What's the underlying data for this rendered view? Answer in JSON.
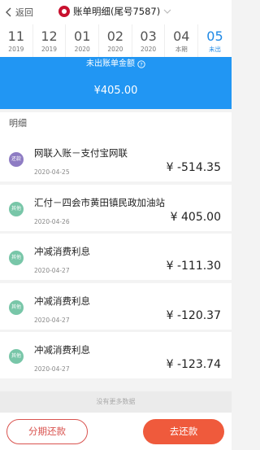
{
  "header": {
    "back_label": "返回",
    "title": "账单明细(尾号7587)"
  },
  "months": [
    {
      "num": "11",
      "sub": "2019"
    },
    {
      "num": "12",
      "sub": "2019"
    },
    {
      "num": "01",
      "sub": "2020"
    },
    {
      "num": "02",
      "sub": "2020"
    },
    {
      "num": "03",
      "sub": "2020"
    },
    {
      "num": "04",
      "sub": "本期"
    },
    {
      "num": "05",
      "sub": "未出"
    }
  ],
  "active_month_index": 6,
  "banner": {
    "label": "未出账单金额",
    "amount": "¥405.00"
  },
  "section_title": "明细",
  "items": [
    {
      "badge": "还款",
      "badge_color": "#8e7cc3",
      "title": "网联入账－支付宝网联",
      "date": "2020-04-25",
      "amount": "¥ -514.35"
    },
    {
      "badge": "其他",
      "badge_color": "#78c6a8",
      "title": "汇付－四会市黄田镇民政加油站",
      "date": "2020-04-26",
      "amount": "¥ 405.00"
    },
    {
      "badge": "其他",
      "badge_color": "#78c6a8",
      "title": "冲减消费利息",
      "date": "2020-04-27",
      "amount": "¥ -111.30"
    },
    {
      "badge": "其他",
      "badge_color": "#78c6a8",
      "title": "冲减消费利息",
      "date": "2020-04-27",
      "amount": "¥ -120.37"
    },
    {
      "badge": "其他",
      "badge_color": "#78c6a8",
      "title": "冲减消费利息",
      "date": "2020-04-27",
      "amount": "¥ -123.74"
    }
  ],
  "no_more_text": "没有更多数据",
  "buttons": {
    "installment": "分期还款",
    "repay": "去还款"
  },
  "colors": {
    "accent_blue": "#2196f3",
    "repay_red": "#ef5a3c"
  }
}
